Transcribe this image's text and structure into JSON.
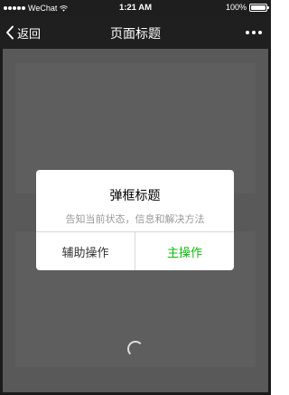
{
  "status_bar": {
    "carrier": "WeChat",
    "time": "1:21 AM",
    "battery_percent": "100%",
    "battery_level": 1.0
  },
  "nav_bar": {
    "back_label": "返回",
    "title": "页面标题",
    "back_icon": "chevron-left-icon",
    "more_icon": "more-icon"
  },
  "dialog": {
    "title": "弹框标题",
    "message": "告知当前状态，信息和解决方法",
    "secondary_action": "辅助操作",
    "primary_action": "主操作"
  },
  "colors": {
    "primary_action": "#09bb07",
    "overlay": "#595959",
    "nav_background": "#1f1f1f"
  }
}
